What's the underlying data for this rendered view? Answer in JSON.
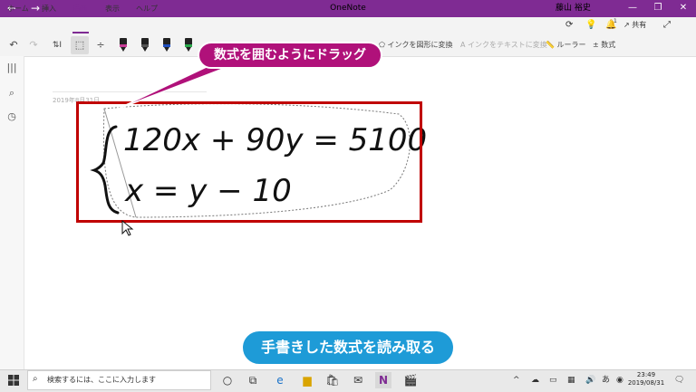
{
  "window": {
    "title": "OneNote",
    "user": "藤山 裕史",
    "nav_back": "←",
    "nav_forward": "→",
    "min": "—",
    "restore": "❐",
    "close": "✕"
  },
  "tabs": [
    {
      "label": "ホーム"
    },
    {
      "label": "挿入"
    },
    {
      "label": "描画"
    },
    {
      "label": "表示"
    },
    {
      "label": "ヘルプ"
    }
  ],
  "ribbon_right": {
    "share_label": "共有",
    "notification_count": "1"
  },
  "toolbar": {
    "ink_to_shape": "インクを図形に変換",
    "ink_to_text": "インクをテキストに変換",
    "ruler": "ルーラー",
    "math": "数式",
    "pen_colors": [
      "#c83c96",
      "#222222",
      "#1f4fbf",
      "#2aa84a"
    ]
  },
  "page": {
    "date": "2019年8月31日"
  },
  "ink": {
    "line1": "120x + 90y = 5100",
    "line2": "x = y − 10"
  },
  "callout": {
    "text": "数式を囲むようにドラッグ"
  },
  "caption": {
    "text": "手書きした数式を読み取る"
  },
  "taskbar": {
    "search_placeholder": "検索するには、ここに入力します",
    "time": "23:49",
    "date": "2019/08/31"
  },
  "colors": {
    "accent": "#7f2b93",
    "highlight_red": "#c00000",
    "callout_magenta": "#b0117a",
    "caption_blue": "#1e9bd7"
  }
}
